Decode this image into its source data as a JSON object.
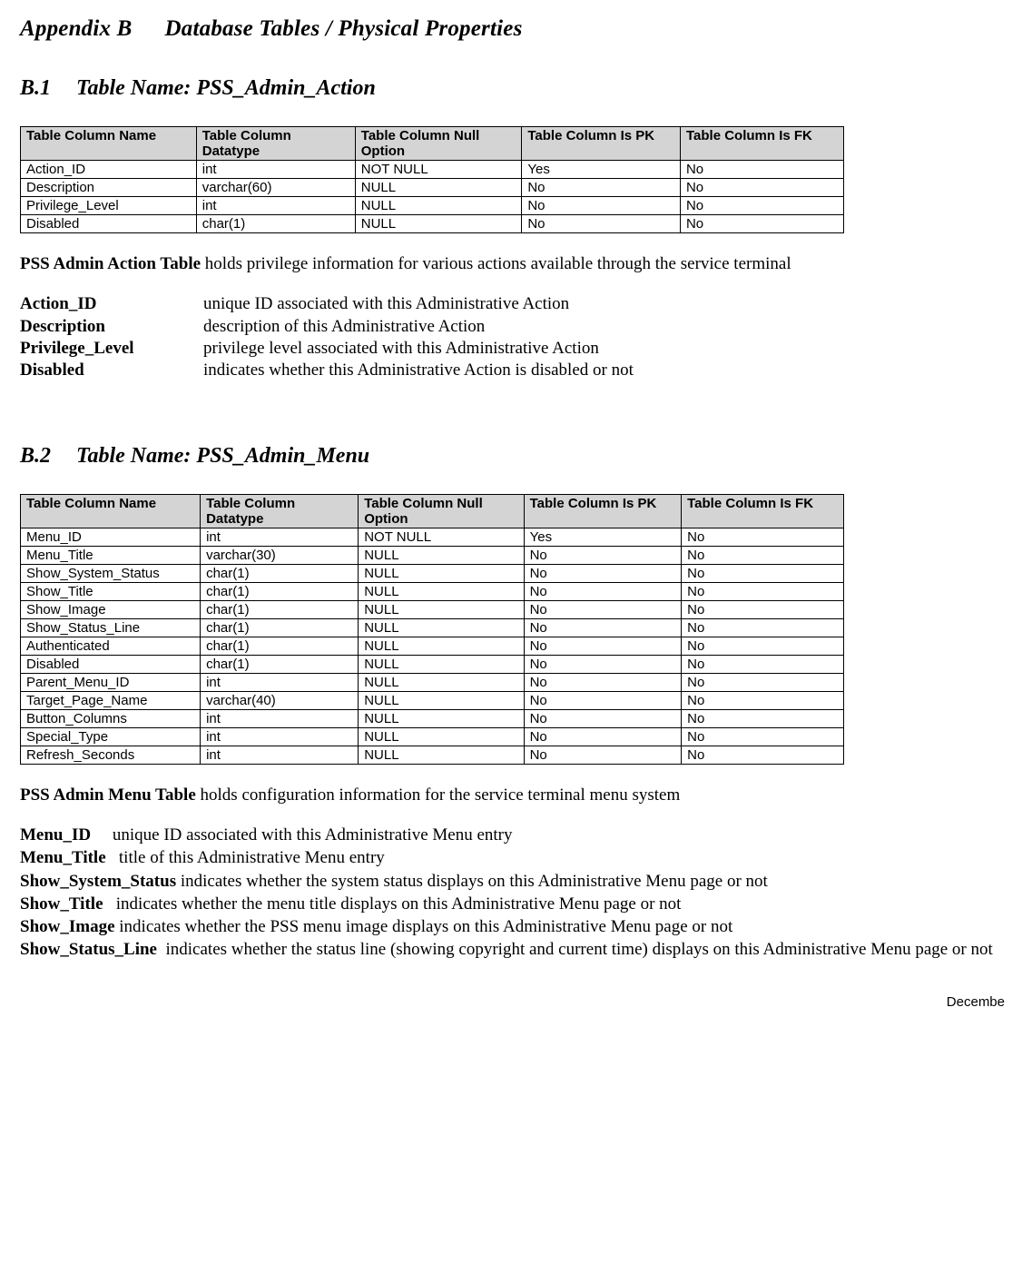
{
  "appendix_title_a": "Appendix B",
  "appendix_title_b": "Database Tables / Physical Properties",
  "sectionB1": {
    "num": "B.1",
    "title": "Table Name: PSS_Admin_Action",
    "headers": {
      "name": "Table Column Name",
      "dtype": "Table Column Datatype",
      "null": "Table Column Null Option",
      "pk": "Table Column Is PK",
      "fk": "Table Column Is FK"
    },
    "rows": [
      {
        "name": "Action_ID",
        "dtype": "int",
        "null": "NOT NULL",
        "pk": "Yes",
        "fk": "No"
      },
      {
        "name": "Description",
        "dtype": "varchar(60)",
        "null": "NULL",
        "pk": "No",
        "fk": "No"
      },
      {
        "name": "Privilege_Level",
        "dtype": "int",
        "null": "NULL",
        "pk": "No",
        "fk": "No"
      },
      {
        "name": "Disabled",
        "dtype": "char(1)",
        "null": "NULL",
        "pk": "No",
        "fk": "No"
      }
    ],
    "table_desc_lead": "PSS Admin Action Table",
    "table_desc_rest": " holds privilege information for various actions available through the service terminal",
    "fields": [
      {
        "label": "Action_ID",
        "text": "unique ID associated with this Administrative Action"
      },
      {
        "label": "Description",
        "text": "description of this Administrative Action"
      },
      {
        "label": "Privilege_Level",
        "text": "privilege level associated with this Administrative Action"
      },
      {
        "label": "Disabled",
        "text": "indicates whether this Administrative Action is disabled or not"
      }
    ]
  },
  "sectionB2": {
    "num": "B.2",
    "title": "Table Name: PSS_Admin_Menu",
    "headers": {
      "name": "Table Column Name",
      "dtype": "Table Column Datatype",
      "null": "Table Column Null Option",
      "pk": "Table Column Is PK",
      "fk": "Table Column Is FK"
    },
    "rows": [
      {
        "name": "Menu_ID",
        "dtype": "int",
        "null": "NOT NULL",
        "pk": "Yes",
        "fk": "No"
      },
      {
        "name": "Menu_Title",
        "dtype": "varchar(30)",
        "null": "NULL",
        "pk": "No",
        "fk": "No"
      },
      {
        "name": "Show_System_Status",
        "dtype": "char(1)",
        "null": "NULL",
        "pk": "No",
        "fk": "No"
      },
      {
        "name": "Show_Title",
        "dtype": "char(1)",
        "null": "NULL",
        "pk": "No",
        "fk": "No"
      },
      {
        "name": "Show_Image",
        "dtype": "char(1)",
        "null": "NULL",
        "pk": "No",
        "fk": "No"
      },
      {
        "name": "Show_Status_Line",
        "dtype": "char(1)",
        "null": "NULL",
        "pk": "No",
        "fk": "No"
      },
      {
        "name": "Authenticated",
        "dtype": "char(1)",
        "null": "NULL",
        "pk": "No",
        "fk": "No"
      },
      {
        "name": "Disabled",
        "dtype": "char(1)",
        "null": "NULL",
        "pk": "No",
        "fk": "No"
      },
      {
        "name": "Parent_Menu_ID",
        "dtype": "int",
        "null": "NULL",
        "pk": "No",
        "fk": "No"
      },
      {
        "name": "Target_Page_Name",
        "dtype": "varchar(40)",
        "null": "NULL",
        "pk": "No",
        "fk": "No"
      },
      {
        "name": "Button_Columns",
        "dtype": "int",
        "null": "NULL",
        "pk": "No",
        "fk": "No"
      },
      {
        "name": "Special_Type",
        "dtype": "int",
        "null": "NULL",
        "pk": "No",
        "fk": "No"
      },
      {
        "name": "Refresh_Seconds",
        "dtype": "int",
        "null": "NULL",
        "pk": "No",
        "fk": "No"
      }
    ],
    "table_desc_lead": "PSS Admin Menu Table",
    "table_desc_rest": " holds configuration information for the service terminal menu system",
    "fields": [
      {
        "label": "Menu_ID",
        "text": "unique ID associated with this Administrative Menu entry",
        "pad": "     "
      },
      {
        "label": "Menu_Title",
        "text": "title of this Administrative Menu entry",
        "pad": "   "
      },
      {
        "label": "Show_System_Status",
        "text": "indicates whether the system status displays on this Administrative Menu page or not",
        "pad": " "
      },
      {
        "label": "Show_Title",
        "text": "indicates whether the menu title displays on this Administrative Menu page or not",
        "pad": "   "
      },
      {
        "label": "Show_Image",
        "text": "indicates whether the PSS menu image displays on this Administrative Menu page or not",
        "pad": " "
      },
      {
        "label": "Show_Status_Line",
        "text": "indicates whether the status line (showing copyright and current time) displays on this Administrative Menu page or not",
        "pad": "  "
      }
    ]
  },
  "footer_text": "Decembe"
}
